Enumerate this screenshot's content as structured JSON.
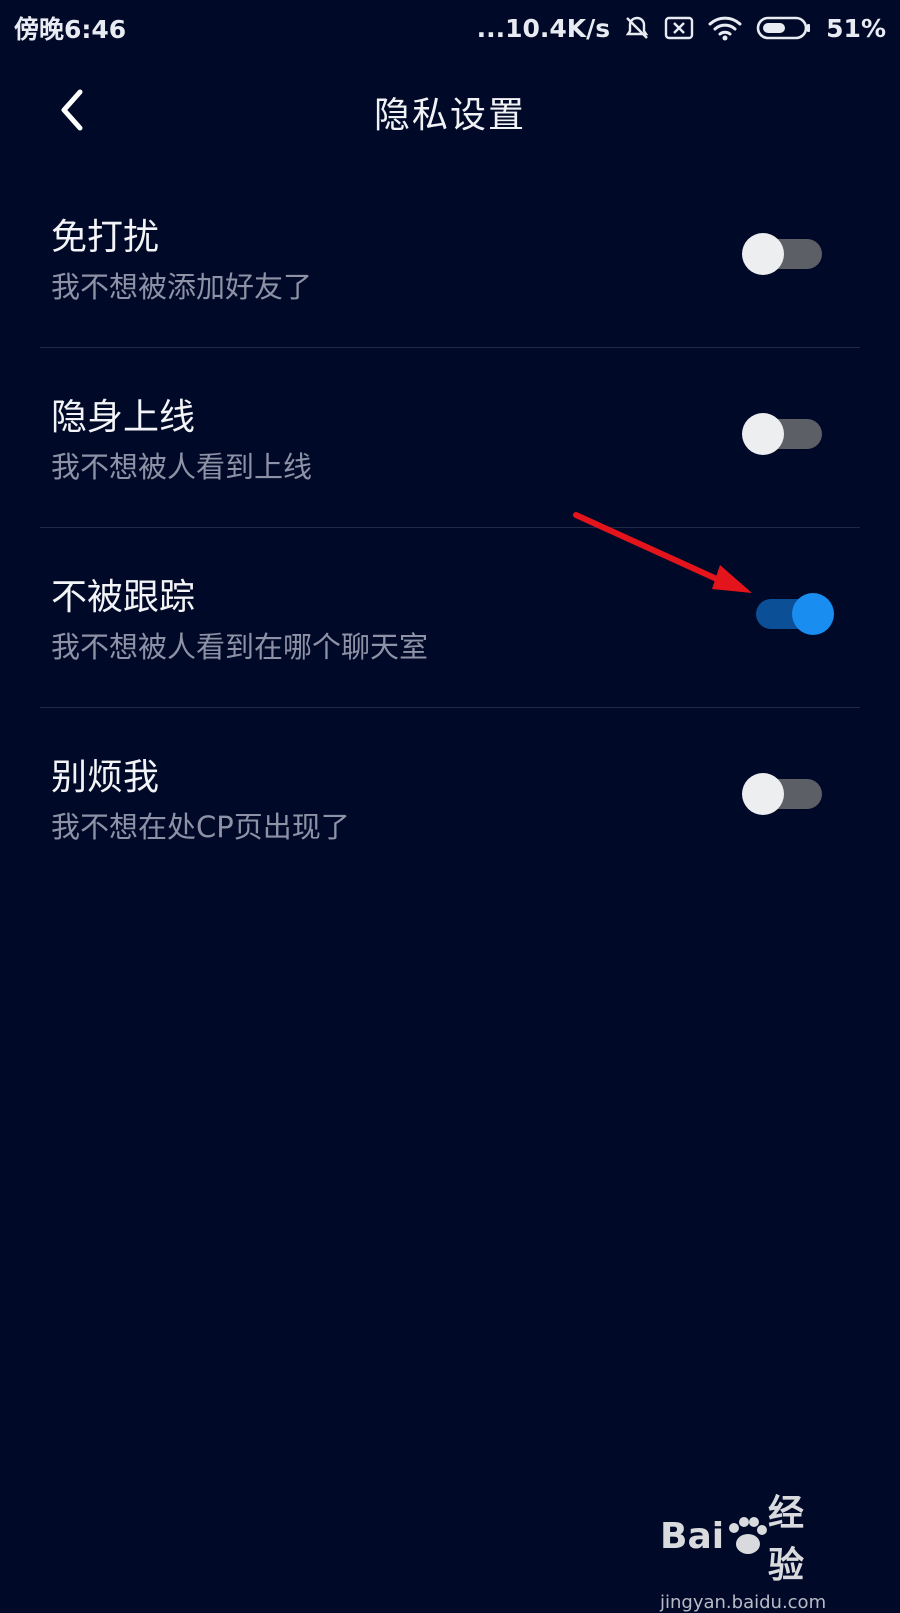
{
  "status_bar": {
    "time": "傍晚6:46",
    "network_speed": "...10.4K/s",
    "battery_percent": "51%",
    "battery_level": 0.51
  },
  "header": {
    "back_icon": "chevron-left-icon",
    "title": "隐私设置"
  },
  "settings": [
    {
      "title": "免打扰",
      "desc": "我不想被添加好友了",
      "enabled": false
    },
    {
      "title": "隐身上线",
      "desc": "我不想被人看到上线",
      "enabled": false
    },
    {
      "title": "不被跟踪",
      "desc": "我不想被人看到在哪个聊天室",
      "enabled": true
    },
    {
      "title": "别烦我",
      "desc": "我不想在处CP页出现了",
      "enabled": false
    }
  ],
  "annotation": {
    "arrow_color": "#e3141c"
  },
  "watermark": {
    "logo_text": "Bai",
    "logo_suffix": "经验",
    "url": "jingyan.baidu.com"
  },
  "colors": {
    "background": "#000927",
    "accent": "#1a8df1"
  }
}
